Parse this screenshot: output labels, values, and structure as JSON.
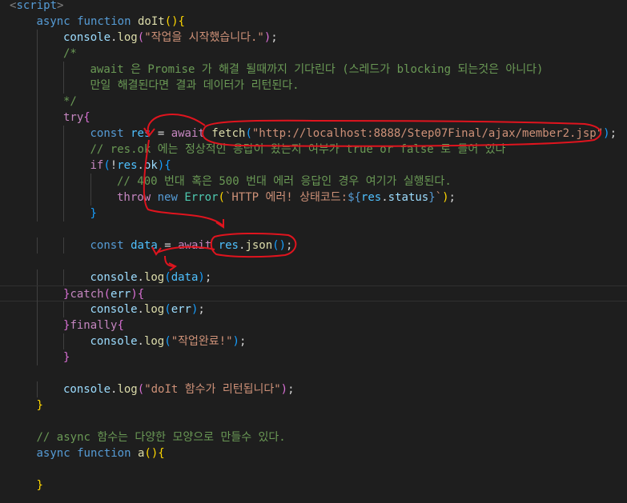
{
  "editor": {
    "theme": {
      "background": "#1e1e1e",
      "guide": "#404040",
      "annotation": "#e0141e"
    },
    "colors": {
      "tag": "#808080",
      "tagname": "#569cd6",
      "kw": "#569cd6",
      "ctrl": "#c586c0",
      "fn": "#dcdcaa",
      "var": "#9cdcfe",
      "const": "#4fc1ff",
      "str": "#ce9178",
      "cmt": "#6a9955",
      "type": "#4ec9b0",
      "num": "#b5cea8",
      "punc": "#d4d4d4",
      "b1": "#ffd700",
      "b2": "#da70d6",
      "b3": "#179fff"
    },
    "lines": [
      {
        "indent": 0,
        "tokens": [
          [
            "<",
            "tag"
          ],
          [
            "script",
            "tagname"
          ],
          [
            ">",
            "tag"
          ]
        ]
      },
      {
        "indent": 1,
        "tokens": [
          [
            "async",
            "kw"
          ],
          [
            " ",
            "punc"
          ],
          [
            "function",
            "kw"
          ],
          [
            " ",
            "punc"
          ],
          [
            "doIt",
            "fn"
          ],
          [
            "()",
            "b1"
          ],
          [
            "{",
            "b1"
          ]
        ]
      },
      {
        "indent": 2,
        "tokens": [
          [
            "console",
            "var"
          ],
          [
            ".",
            "punc"
          ],
          [
            "log",
            "fn"
          ],
          [
            "(",
            "b2"
          ],
          [
            "\"작업을 시작했습니다.\"",
            "str"
          ],
          [
            ")",
            "b2"
          ],
          [
            ";",
            "punc"
          ]
        ]
      },
      {
        "indent": 2,
        "tokens": [
          [
            "/*",
            "cmt"
          ]
        ]
      },
      {
        "indent": 3,
        "tokens": [
          [
            "await 은 Promise 가 해결 될때까지 기다린다 (스레드가 blocking 되는것은 아니다)",
            "cmt"
          ]
        ]
      },
      {
        "indent": 3,
        "tokens": [
          [
            "만일 해결된다면 결과 데이터가 리턴된다.",
            "cmt"
          ]
        ]
      },
      {
        "indent": 2,
        "tokens": [
          [
            "*/",
            "cmt"
          ]
        ]
      },
      {
        "indent": 2,
        "tokens": [
          [
            "try",
            "ctrl"
          ],
          [
            "{",
            "b2"
          ]
        ]
      },
      {
        "indent": 3,
        "tokens": [
          [
            "const",
            "kw"
          ],
          [
            " ",
            "punc"
          ],
          [
            "res",
            "const"
          ],
          [
            " = ",
            "punc"
          ],
          [
            "await",
            "ctrl"
          ],
          [
            " ",
            "punc"
          ],
          [
            "fetch",
            "fn"
          ],
          [
            "(",
            "b3"
          ],
          [
            "\"http://localhost:8888/Step07Final/ajax/member2.jsp\"",
            "str"
          ],
          [
            ")",
            "b3"
          ],
          [
            ";",
            "punc"
          ]
        ]
      },
      {
        "indent": 3,
        "tokens": [
          [
            "// res.ok 에는 정상적인 응답이 왔는지 여부가 true or false 로 들어 있다",
            "cmt"
          ]
        ]
      },
      {
        "indent": 3,
        "tokens": [
          [
            "if",
            "ctrl"
          ],
          [
            "(",
            "b3"
          ],
          [
            "!",
            "punc"
          ],
          [
            "res",
            "const"
          ],
          [
            ".",
            "punc"
          ],
          [
            "ok",
            "var"
          ],
          [
            ")",
            "b3"
          ],
          [
            "{",
            "b3"
          ]
        ]
      },
      {
        "indent": 4,
        "tokens": [
          [
            "// 400 번대 혹은 500 번대 에러 응답인 경우 여기가 실행된다.",
            "cmt"
          ]
        ]
      },
      {
        "indent": 4,
        "tokens": [
          [
            "throw",
            "ctrl"
          ],
          [
            " ",
            "punc"
          ],
          [
            "new",
            "kw"
          ],
          [
            " ",
            "punc"
          ],
          [
            "Error",
            "type"
          ],
          [
            "(",
            "b1"
          ],
          [
            "`HTTP 에러! 상태코드:",
            "str"
          ],
          [
            "${",
            "kw"
          ],
          [
            "res",
            "const"
          ],
          [
            ".",
            "punc"
          ],
          [
            "status",
            "var"
          ],
          [
            "}",
            "kw"
          ],
          [
            "`",
            "str"
          ],
          [
            ")",
            "b1"
          ],
          [
            ";",
            "punc"
          ]
        ]
      },
      {
        "indent": 3,
        "tokens": [
          [
            "}",
            "b3"
          ]
        ]
      },
      {
        "indent": 0,
        "tokens": []
      },
      {
        "indent": 3,
        "tokens": [
          [
            "const",
            "kw"
          ],
          [
            " ",
            "punc"
          ],
          [
            "data",
            "const"
          ],
          [
            " = ",
            "punc"
          ],
          [
            "await",
            "ctrl"
          ],
          [
            " ",
            "punc"
          ],
          [
            "res",
            "const"
          ],
          [
            ".",
            "punc"
          ],
          [
            "json",
            "fn"
          ],
          [
            "()",
            "b3"
          ],
          [
            ";",
            "punc"
          ]
        ]
      },
      {
        "indent": 0,
        "tokens": []
      },
      {
        "indent": 3,
        "tokens": [
          [
            "console",
            "var"
          ],
          [
            ".",
            "punc"
          ],
          [
            "log",
            "fn"
          ],
          [
            "(",
            "b3"
          ],
          [
            "data",
            "const"
          ],
          [
            ")",
            "b3"
          ],
          [
            ";",
            "punc"
          ]
        ]
      },
      {
        "indent": 2,
        "current": true,
        "tokens": [
          [
            "}",
            "b2"
          ],
          [
            "catch",
            "ctrl"
          ],
          [
            "(",
            "b2"
          ],
          [
            "err",
            "var"
          ],
          [
            ")",
            "b2"
          ],
          [
            "{",
            "b2"
          ]
        ]
      },
      {
        "indent": 3,
        "tokens": [
          [
            "console",
            "var"
          ],
          [
            ".",
            "punc"
          ],
          [
            "log",
            "fn"
          ],
          [
            "(",
            "b3"
          ],
          [
            "err",
            "var"
          ],
          [
            ")",
            "b3"
          ],
          [
            ";",
            "punc"
          ]
        ]
      },
      {
        "indent": 2,
        "tokens": [
          [
            "}",
            "b2"
          ],
          [
            "finally",
            "ctrl"
          ],
          [
            "{",
            "b2"
          ]
        ]
      },
      {
        "indent": 3,
        "tokens": [
          [
            "console",
            "var"
          ],
          [
            ".",
            "punc"
          ],
          [
            "log",
            "fn"
          ],
          [
            "(",
            "b3"
          ],
          [
            "\"작업완료!\"",
            "str"
          ],
          [
            ")",
            "b3"
          ],
          [
            ";",
            "punc"
          ]
        ]
      },
      {
        "indent": 2,
        "tokens": [
          [
            "}",
            "b2"
          ]
        ]
      },
      {
        "indent": 0,
        "tokens": []
      },
      {
        "indent": 2,
        "tokens": [
          [
            "console",
            "var"
          ],
          [
            ".",
            "punc"
          ],
          [
            "log",
            "fn"
          ],
          [
            "(",
            "b2"
          ],
          [
            "\"doIt 함수가 리턴됩니다\"",
            "str"
          ],
          [
            ")",
            "b2"
          ],
          [
            ";",
            "punc"
          ]
        ]
      },
      {
        "indent": 1,
        "tokens": [
          [
            "}",
            "b1"
          ]
        ]
      },
      {
        "indent": 0,
        "tokens": []
      },
      {
        "indent": 1,
        "tokens": [
          [
            "// async 함수는 다양한 모양으로 만들수 있다.",
            "cmt"
          ]
        ]
      },
      {
        "indent": 1,
        "tokens": [
          [
            "async",
            "kw"
          ],
          [
            " ",
            "punc"
          ],
          [
            "function",
            "kw"
          ],
          [
            " ",
            "punc"
          ],
          [
            "a",
            "fn"
          ],
          [
            "()",
            "b1"
          ],
          [
            "{",
            "b1"
          ]
        ]
      },
      {
        "indent": 0,
        "tokens": []
      },
      {
        "indent": 1,
        "tokens": [
          [
            "}",
            "b1"
          ]
        ]
      }
    ]
  }
}
